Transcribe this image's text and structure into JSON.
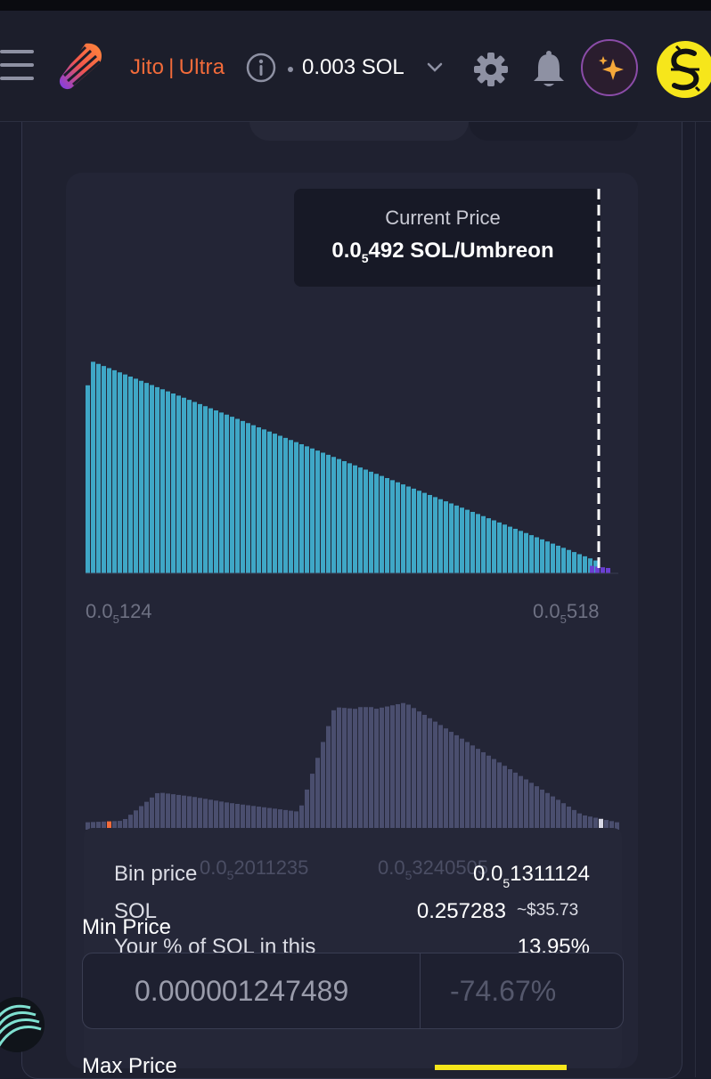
{
  "header": {
    "rpc_left": "Jito",
    "rpc_sep": "|",
    "rpc_right": "Ultra",
    "priority_fee": "0.003 SOL",
    "brand_color": "#f26b3a",
    "icons": [
      "hamburger-icon",
      "logo-icon",
      "info-icon",
      "chevron-down-icon",
      "gear-icon",
      "bell-icon",
      "sparkle-icon",
      "avatar-icon"
    ]
  },
  "tooltip": {
    "title": "Current Price",
    "price_main": "0.0",
    "price_sub": "5",
    "price_rest": "492 SOL/Umbreon"
  },
  "axis": {
    "left_main": "0.0",
    "left_sub": "5",
    "left_rest": "124",
    "right_main": "0.0",
    "right_sub": "5",
    "right_rest": "518"
  },
  "lower_axis": {
    "left_main": "0.0",
    "left_sub": "5",
    "left_rest": "2011235",
    "right_main": "0.0",
    "right_sub": "5",
    "right_rest": "3240505"
  },
  "bin_tooltip": {
    "bin_price_label": "Bin price",
    "bin_price_main": "0.0",
    "bin_price_sub": "5",
    "bin_price_rest": "1311124",
    "sol_label": "SOL",
    "sol_value": "0.257283",
    "sol_usd": "~$35.73",
    "pct_label": "Your % of SOL in this",
    "pct_value": "13.95%"
  },
  "range": {
    "min_label": "Min Price",
    "min_value": "0.000001247489",
    "min_pct": "-74.67%",
    "max_label": "Max Price"
  },
  "chart_data": [
    {
      "type": "bar",
      "title": "",
      "x_range": [
        "0.0₅124",
        "0.0₅518"
      ],
      "current_price": "0.0₅492 SOL/Umbreon",
      "series": [
        {
          "color": "#3fa7c6",
          "shape": "linear decreasing",
          "values": [
            1.0,
            0.06
          ]
        },
        {
          "color": "#6a3fd2",
          "note": "bins right of current price",
          "values": [
            0.07,
            0.05
          ]
        }
      ]
    },
    {
      "type": "bar",
      "title": "",
      "x_range": [
        "0.0₅2011235",
        "0.0₅3240505"
      ],
      "series": [
        {
          "color": "#4a4e6e",
          "values": [
            0.05,
            0.06,
            0.25,
            0.22,
            0.18,
            0.15,
            0.12,
            0.82,
            0.8,
            0.85,
            0.7,
            0.55,
            0.4,
            0.25,
            0.1,
            0.05
          ]
        }
      ]
    }
  ]
}
